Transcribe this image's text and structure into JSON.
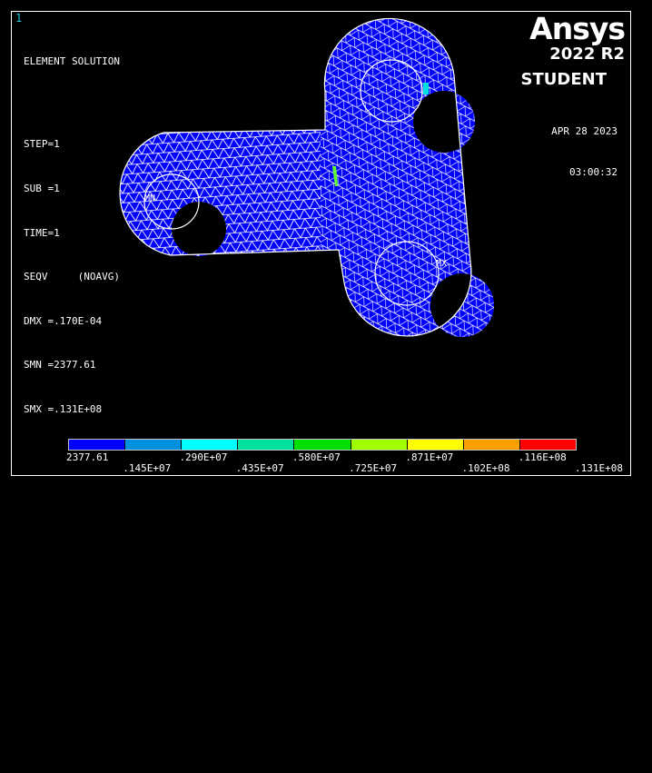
{
  "window_number": "1",
  "info": {
    "title": "ELEMENT SOLUTION",
    "step": "STEP=1",
    "sub": "SUB =1",
    "time": "TIME=1",
    "result": "SEQV     (NOAVG)",
    "dmx": "DMX =.170E-04",
    "smn": "SMN =2377.61",
    "smx": "SMX =.131E+08"
  },
  "brand": {
    "name": "Ansys",
    "version": "2022 R2",
    "edition": "STUDENT"
  },
  "date": "APR 28 2023",
  "time": "03:00:32",
  "markers": {
    "min": "MN",
    "max": "MX"
  },
  "legend": {
    "colors": [
      "#0000ff",
      "#0090e0",
      "#00ffff",
      "#00e0a0",
      "#00e000",
      "#a0ff00",
      "#ffff00",
      "#ffa000",
      "#ff0000"
    ],
    "top_labels": [
      "2377.61",
      ".290E+07",
      ".580E+07",
      ".871E+07",
      ".116E+08"
    ],
    "bottom_labels": [
      ".145E+07",
      ".435E+07",
      ".725E+07",
      ".102E+08",
      ".131E+08"
    ]
  },
  "colors": {
    "mesh_fill": "#0000ff",
    "mesh_lines": "#ffffff",
    "window_number": "#22c7d8"
  }
}
